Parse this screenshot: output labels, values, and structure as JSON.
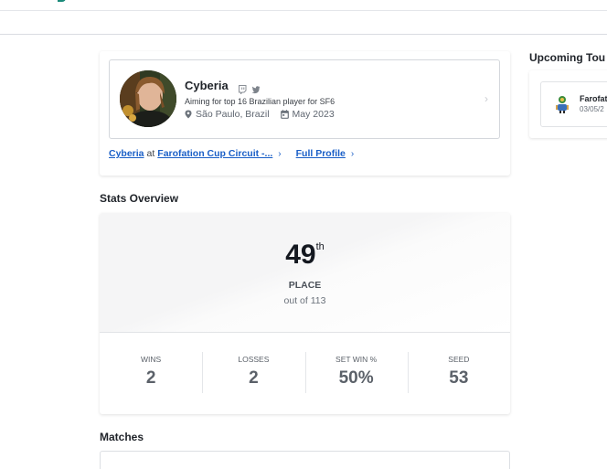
{
  "profile": {
    "name": "Cyberia",
    "bio": "Aiming for top 16 Brazilian player for SF6",
    "location": "São Paulo, Brazil",
    "joined": "May 2023",
    "social_icons": [
      "twitch-icon",
      "twitter-icon"
    ],
    "links": {
      "player_link": "Cyberia",
      "at_text": "at",
      "event_link": "Farofation Cup Circuit -...",
      "full_profile": "Full Profile"
    }
  },
  "stats": {
    "title": "Stats Overview",
    "place": "49",
    "place_suffix": "th",
    "place_label": "PLACE",
    "out_of": "out of 113",
    "items": [
      {
        "label": "WINS",
        "value": "2"
      },
      {
        "label": "LOSSES",
        "value": "2"
      },
      {
        "label": "SET WIN %",
        "value": "50%"
      },
      {
        "label": "SEED",
        "value": "53"
      }
    ]
  },
  "matches": {
    "title": "Matches"
  },
  "upcoming": {
    "title": "Upcoming Tou",
    "item_name": "Farofat",
    "item_date": "03/05/2"
  },
  "colors": {
    "link": "#1a5fc7",
    "accent": "#1b8a7a",
    "text_dark": "#141820",
    "text_muted": "#5b6169"
  }
}
